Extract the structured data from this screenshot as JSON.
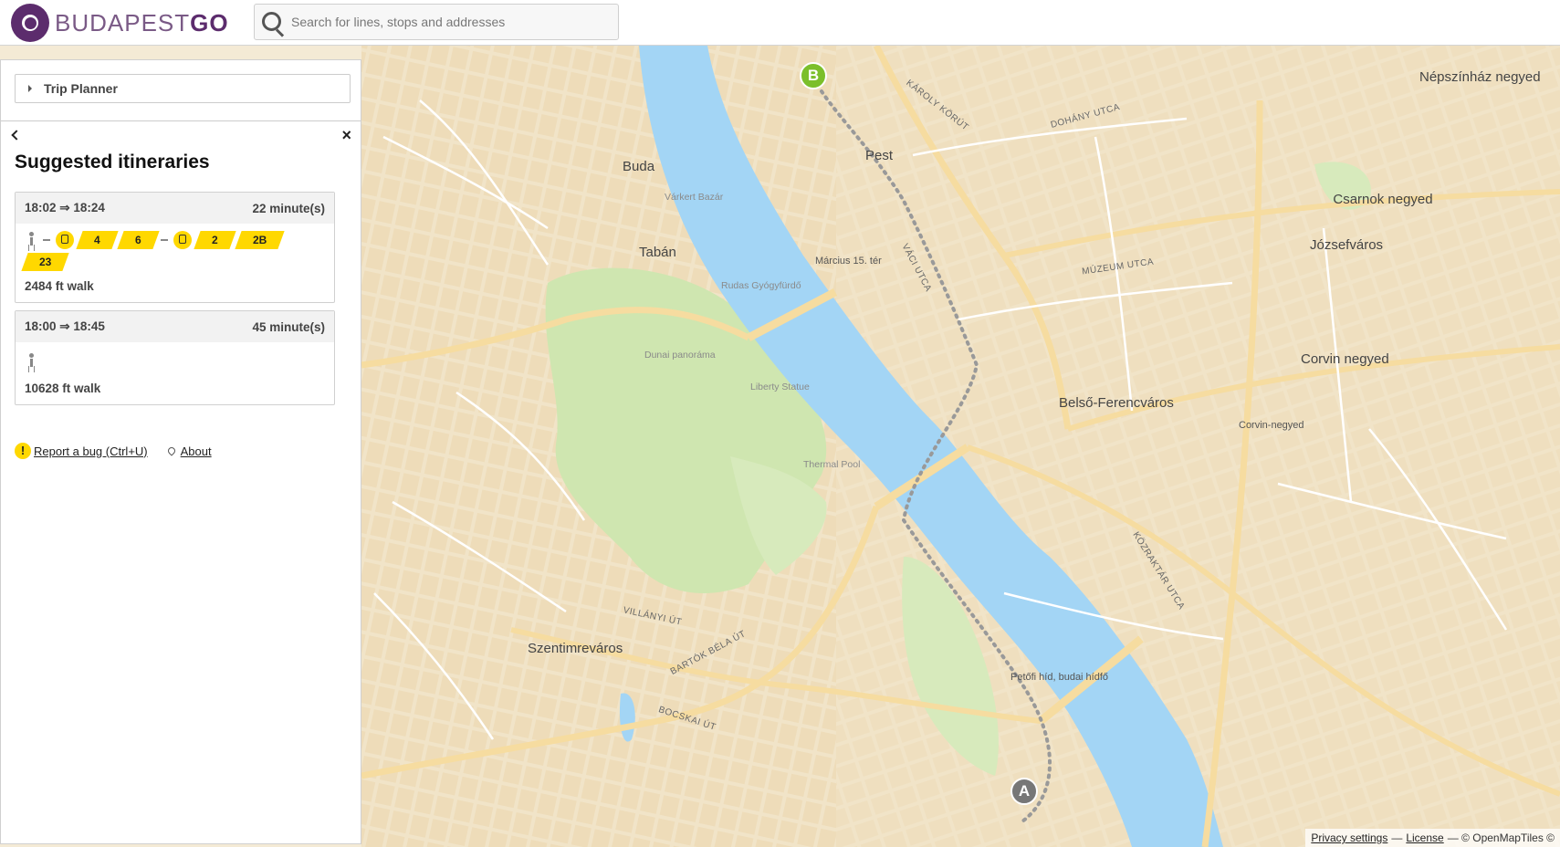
{
  "header": {
    "logo_light": "BUDAPEST",
    "logo_bold": "GO",
    "search_placeholder": "Search for lines, stops and addresses"
  },
  "panel": {
    "trip_planner_label": "Trip Planner",
    "title": "Suggested itineraries",
    "itineraries": [
      {
        "depart": "18:02",
        "arrive": "18:24",
        "duration": "22 minute(s)",
        "legs_group1": [
          "4",
          "6"
        ],
        "legs_group2": [
          "2",
          "2B",
          "23"
        ],
        "walk": "2484 ft walk"
      },
      {
        "depart": "18:00",
        "arrive": "18:45",
        "duration": "45 minute(s)",
        "walk": "10628 ft walk"
      }
    ],
    "arrow": "⇒",
    "report_bug": "Report a bug (Ctrl+U)",
    "about": "About"
  },
  "map": {
    "districts": [
      "Népszínház negyed",
      "Csarnok negyed",
      "Józsefváros",
      "Corvin negyed",
      "Belső-Ferencváros",
      "Szentimreváros",
      "Pest",
      "Buda",
      "Tabán"
    ],
    "pois": [
      "Corvin-negyed",
      "Március 15. tér",
      "Rudas Gyógyfürdő",
      "Petőfi híd, budai hídfő",
      "Liberty Statue",
      "Thermal Pool",
      "Várkert Bazár",
      "Dunai panoráma"
    ],
    "streets": [
      "KÁROLY KÖRÚT",
      "DOHÁNY UTCA",
      "MÚZEUM UTCA",
      "VÁCI UTCA",
      "BARTÓK BÉLA ÚT",
      "VILLÁNYI ÚT",
      "BOCSKAI ÚT",
      "KÖZRAKTÁR UTCA"
    ],
    "marker_a": "A",
    "marker_b": "B",
    "colors": {
      "water": "#a3d5f5",
      "land": "#f4ead5",
      "park": "#cfe6b0",
      "road": "#ffffff",
      "major_road": "#f6dca0"
    }
  },
  "attribution": {
    "privacy": "Privacy settings",
    "license": "License",
    "sep": "—",
    "copy": "— © OpenMapTiles ©"
  }
}
